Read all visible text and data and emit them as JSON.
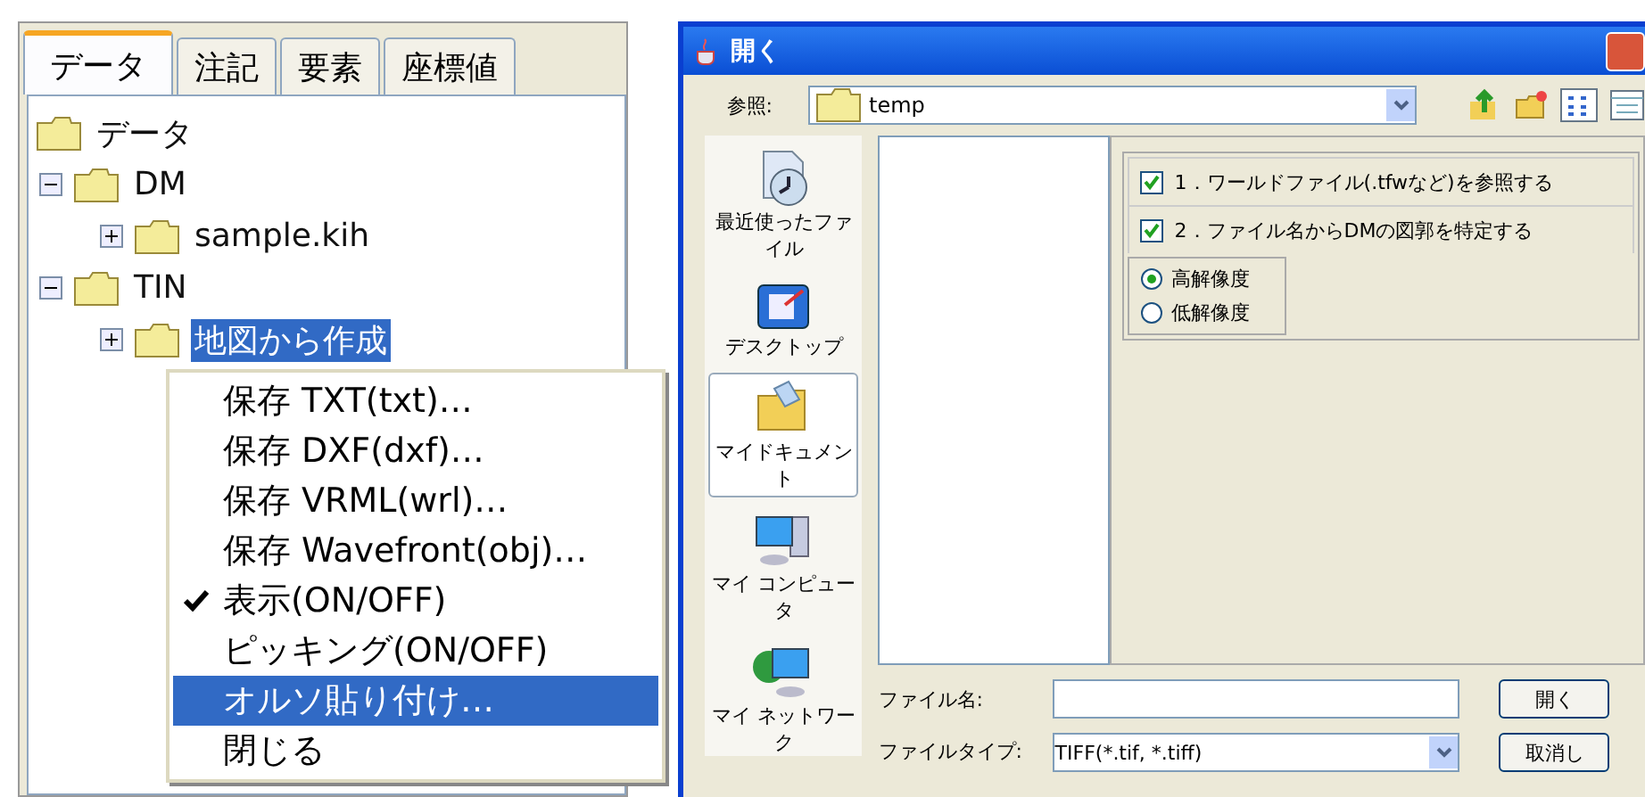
{
  "tree_panel": {
    "tabs": [
      {
        "label": "データ",
        "selected": true
      },
      {
        "label": "注記",
        "selected": false
      },
      {
        "label": "要素",
        "selected": false
      },
      {
        "label": "座標値",
        "selected": false
      }
    ],
    "tree": [
      {
        "label": "データ",
        "selected": false,
        "children": [
          {
            "label": "DM",
            "expanded": true,
            "selected": false,
            "children": [
              {
                "label": "sample.kih",
                "expanded": false,
                "selected": false
              }
            ]
          },
          {
            "label": "TIN",
            "expanded": true,
            "selected": false,
            "children": [
              {
                "label": "地図から作成",
                "expanded": false,
                "selected": true
              }
            ]
          }
        ]
      }
    ],
    "context_menu": [
      {
        "label": "保存 TXT(txt)…",
        "checked": false,
        "selected": false
      },
      {
        "label": "保存 DXF(dxf)…",
        "checked": false,
        "selected": false
      },
      {
        "label": "保存 VRML(wrl)…",
        "checked": false,
        "selected": false
      },
      {
        "label": "保存 Wavefront(obj)…",
        "checked": false,
        "selected": false
      },
      {
        "label": "表示(ON/OFF)",
        "checked": true,
        "selected": false
      },
      {
        "label": "ピッキング(ON/OFF)",
        "checked": false,
        "selected": false
      },
      {
        "label": "オルソ貼り付け…",
        "checked": false,
        "selected": true
      },
      {
        "label": "閉じる",
        "checked": false,
        "selected": false
      }
    ]
  },
  "dialog": {
    "title": "開く",
    "look_in_label": "参照:",
    "look_in_value": "temp",
    "places": [
      {
        "label": "最近使ったファイル",
        "kind": "recent",
        "selected": false
      },
      {
        "label": "デスクトップ",
        "kind": "desktop",
        "selected": false
      },
      {
        "label": "マイドキュメント",
        "kind": "documents",
        "selected": true
      },
      {
        "label": "マイ コンピュータ",
        "kind": "computer",
        "selected": false
      },
      {
        "label": "マイ ネットワーク",
        "kind": "network",
        "selected": false
      }
    ],
    "options": [
      {
        "label": "1．ワールドファイル(.tfwなど)を参照する",
        "checked": true
      },
      {
        "label": "2．ファイル名からDMの図郭を特定する",
        "checked": true
      }
    ],
    "resolutions": [
      {
        "label": "高解像度",
        "selected": true
      },
      {
        "label": "低解像度",
        "selected": false
      }
    ],
    "file_name_label": "ファイル名:",
    "file_type_label": "ファイルタイプ:",
    "file_type_value": "TIFF(*.tif, *.tiff)",
    "buttons": [
      "開く",
      "取消し"
    ]
  }
}
